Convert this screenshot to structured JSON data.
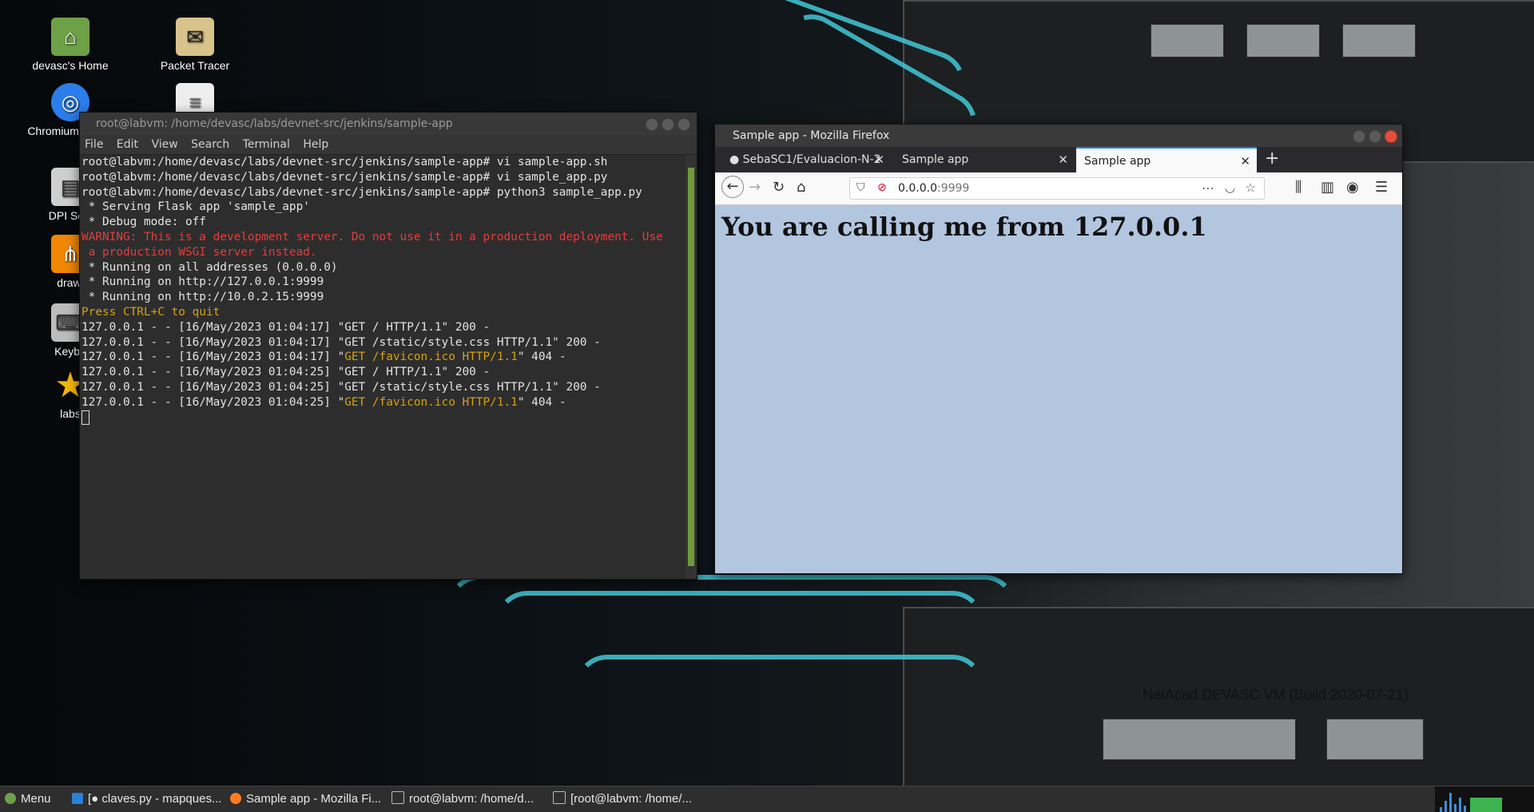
{
  "desktop": {
    "wallpaper_caption": "NetAcad DEVASC VM (Build 2020-07-21)",
    "icons": [
      {
        "label": "devasc's Home",
        "icon": "folder-home-icon"
      },
      {
        "label": "Packet Tracer",
        "icon": "packet-tracer-icon"
      },
      {
        "label": "Chromium Brows",
        "icon": "chromium-icon"
      },
      {
        "label": "DPI Scal",
        "icon": "dpi-scale-icon"
      },
      {
        "label": "draw.",
        "icon": "drawio-icon"
      },
      {
        "label": "Keybo",
        "icon": "keyboard-icon"
      },
      {
        "label": "labs",
        "icon": "star-icon"
      }
    ]
  },
  "terminal": {
    "title": "root@labvm: /home/devasc/labs/devnet-src/jenkins/sample-app",
    "menu": [
      "File",
      "Edit",
      "View",
      "Search",
      "Terminal",
      "Help"
    ],
    "lines": [
      {
        "text": "root@labvm:/home/devasc/labs/devnet-src/jenkins/sample-app# vi sample-app.sh",
        "color": "default"
      },
      {
        "text": "root@labvm:/home/devasc/labs/devnet-src/jenkins/sample-app# vi sample_app.py",
        "color": "default"
      },
      {
        "text": "root@labvm:/home/devasc/labs/devnet-src/jenkins/sample-app# python3 sample_app.py",
        "color": "default"
      },
      {
        "text": " * Serving Flask app 'sample_app'",
        "color": "default"
      },
      {
        "text": " * Debug mode: off",
        "color": "default"
      },
      {
        "text": "WARNING: This is a development server. Do not use it in a production deployment. Use",
        "color": "red"
      },
      {
        "text": " a production WSGI server instead.",
        "color": "red"
      },
      {
        "text": " * Running on all addresses (0.0.0.0)",
        "color": "default"
      },
      {
        "text": " * Running on http://127.0.0.1:9999",
        "color": "default"
      },
      {
        "text": " * Running on http://10.0.2.15:9999",
        "color": "default"
      },
      {
        "text": "Press CTRL+C to quit",
        "color": "yellow"
      },
      {
        "text": "127.0.0.1 - - [16/May/2023 01:04:17] \"GET / HTTP/1.1\" 200 -",
        "color": "default"
      },
      {
        "text": "127.0.0.1 - - [16/May/2023 01:04:17] \"GET /static/style.css HTTP/1.1\" 200 -",
        "color": "default"
      },
      {
        "prefix": "127.0.0.1 - - [16/May/2023 01:04:17] \"",
        "highlight": "GET /favicon.ico HTTP/1.1",
        "suffix": "\" 404 -",
        "color": "mixed"
      },
      {
        "text": "127.0.0.1 - - [16/May/2023 01:04:25] \"GET / HTTP/1.1\" 200 -",
        "color": "default"
      },
      {
        "text": "127.0.0.1 - - [16/May/2023 01:04:25] \"GET /static/style.css HTTP/1.1\" 200 -",
        "color": "default"
      },
      {
        "prefix": "127.0.0.1 - - [16/May/2023 01:04:25] \"",
        "highlight": "GET /favicon.ico HTTP/1.1",
        "suffix": "\" 404 -",
        "color": "mixed"
      }
    ]
  },
  "firefox": {
    "title": "Sample app - Mozilla Firefox",
    "tabs": [
      {
        "label": "SebaSC1/Evaluacion-N-2",
        "active": false
      },
      {
        "label": "Sample app",
        "active": false
      },
      {
        "label": "Sample app",
        "active": true
      }
    ],
    "url_host": "0.0.0.0",
    "url_port": ":9999",
    "page_heading": "You are calling me from 127.0.0.1"
  },
  "taskbar": {
    "menu_label": "Menu",
    "items": [
      {
        "label": "[● claves.py - mapques...",
        "icon": "vscode-icon"
      },
      {
        "label": "Sample app - Mozilla Fi...",
        "icon": "firefox-icon"
      },
      {
        "label": "root@labvm: /home/d...",
        "icon": "terminal-icon"
      },
      {
        "label": "[root@labvm: /home/...",
        "icon": "terminal-icon"
      }
    ]
  },
  "colors": {
    "terminal_bg": "#2d2d2d",
    "terminal_red": "#e13e3e",
    "terminal_yellow": "#d4a017",
    "page_bg": "#b3c6e0",
    "tab_accent": "#0a84ff"
  }
}
